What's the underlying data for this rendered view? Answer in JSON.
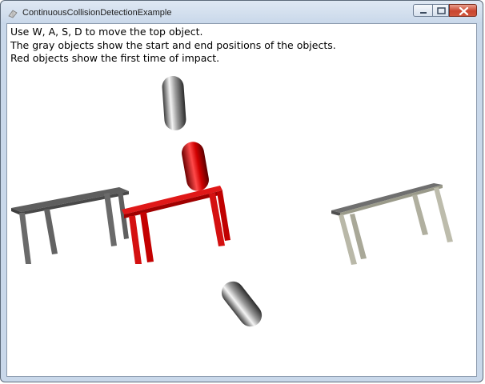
{
  "window": {
    "title": "ContinuousCollisionDetectionExample",
    "icon": "app-icon",
    "controls": [
      "minimize-icon",
      "maximize-icon",
      "close-icon"
    ],
    "close_color": "#c9452f"
  },
  "instructions": {
    "line1": "Use W, A, S, D to move the top object.",
    "line2": "The gray objects show the start and end positions of the objects.",
    "line3": "Red objects show the first time of impact."
  },
  "scene": {
    "start_color": "#808080",
    "impact_color": "#e01010",
    "objects": [
      "capsule-start",
      "capsule-impact",
      "capsule-end",
      "table-start",
      "table-impact",
      "table-end"
    ]
  }
}
